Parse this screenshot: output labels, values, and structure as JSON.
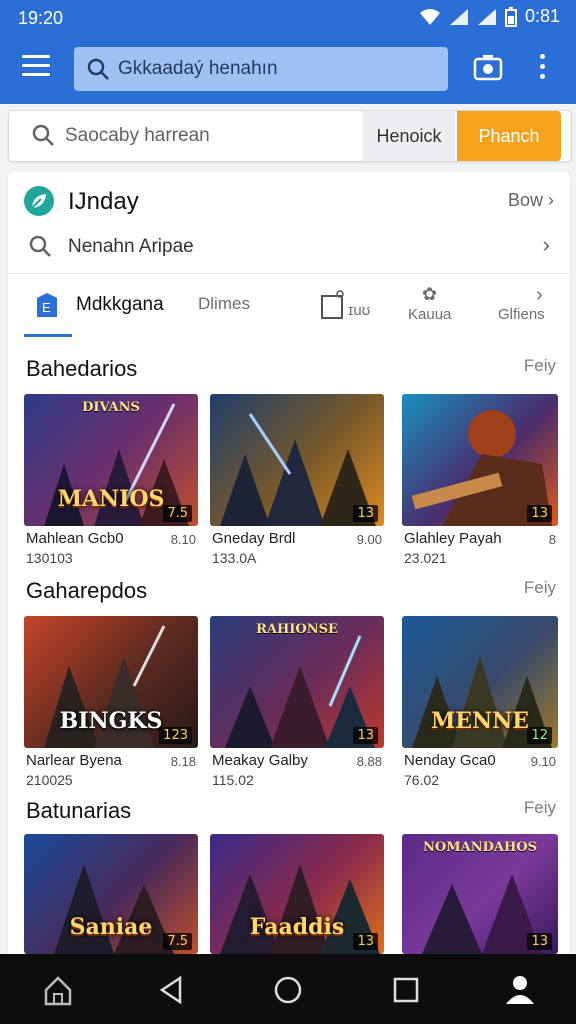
{
  "status": {
    "time": "19:20",
    "clock_right": "0:81"
  },
  "appbar": {
    "search_text": "Gkkaadaý henahın",
    "colors": {
      "primary": "#2b6fd6"
    }
  },
  "search_bar": {
    "placeholder": "Saocaby harrean",
    "secondary_btn": "Henoick",
    "primary_btn": "Phanch",
    "accent": "#f6a21a"
  },
  "header_rows": {
    "title": "IJnday",
    "link": "Bow",
    "search_label": "Nenahn Aripae"
  },
  "tabs": [
    {
      "label": "Mdkkgana",
      "active": true
    },
    {
      "label": "Dlimes"
    },
    {
      "label": "ɪuʊ"
    },
    {
      "label": "Kauua"
    },
    {
      "label": "Glfiens"
    }
  ],
  "sections": [
    {
      "title": "Bahedarios",
      "more": "Feiy",
      "games": [
        {
          "name": "Mahlean Gcb0",
          "rating": "8.10",
          "sub": "130103",
          "badge": "7.5",
          "logo": "MANIOS",
          "head": "DIVANS"
        },
        {
          "name": "Gneday Brdl",
          "rating": "9.00",
          "sub": "133.0A",
          "badge": "13",
          "logo": "",
          "head": ""
        },
        {
          "name": "Glahley Payah",
          "rating": "8",
          "sub": "23.021",
          "badge": "13",
          "logo": "",
          "head": ""
        }
      ]
    },
    {
      "title": "Gaharepdos",
      "more": "Feiy",
      "games": [
        {
          "name": "Narlear Byena",
          "rating": "8.18",
          "sub": "210025",
          "badge": "123",
          "logo": "BINGKS",
          "head": ""
        },
        {
          "name": "Meakay Galby",
          "rating": "8.88",
          "sub": "115.02",
          "badge": "13",
          "logo": "",
          "head": "RAHIONSE"
        },
        {
          "name": "Nenday Gca0",
          "rating": "9.10",
          "sub": "76.02",
          "badge": "12",
          "logo": "MENNE",
          "head": ""
        }
      ]
    },
    {
      "title": "Batunarias",
      "more": "Feiy",
      "games": [
        {
          "name": "",
          "rating": "",
          "sub": "",
          "badge": "7.5",
          "logo": "Saniae",
          "head": ""
        },
        {
          "name": "",
          "rating": "",
          "sub": "",
          "badge": "13",
          "logo": "Faaddis",
          "head": ""
        },
        {
          "name": "",
          "rating": "",
          "sub": "",
          "badge": "13",
          "logo": "",
          "head": "NOMANDAHOS"
        }
      ]
    }
  ],
  "icons": [
    "menu-icon",
    "search-icon",
    "camera-icon",
    "more-vert-icon",
    "leaf-icon",
    "chevron-right-icon",
    "home-icon",
    "back-icon",
    "circle-home-icon",
    "recents-icon",
    "profile-icon"
  ]
}
